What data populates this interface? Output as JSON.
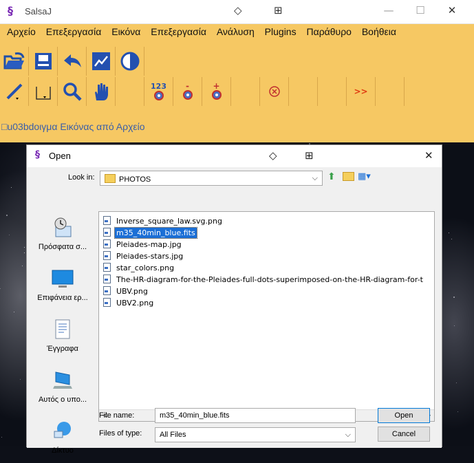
{
  "app": {
    "title": "SalsaJ",
    "menu": [
      "Αρχείο",
      "Επεξεργασία",
      "Εικόνα",
      "Επεξεργασία",
      "Ανάλυση",
      "Plugins",
      "Παράθυρο",
      "Βοήθεια"
    ],
    "status_text": "□u03bdοιγμα Εικόνας από Αρχείο",
    "toolbar_badges": {
      "count": "123",
      "minus": "-",
      "plus": "+",
      "more": ">>"
    }
  },
  "dialog": {
    "title": "Open",
    "look_in_label": "Look in:",
    "look_in_value": "PHOTOS",
    "places": [
      {
        "label": "Πρόσφατα σ...",
        "icon": "recent-places-icon"
      },
      {
        "label": "Επιφάνεια ερ...",
        "icon": "desktop-icon"
      },
      {
        "label": "Έγγραφα",
        "icon": "documents-icon"
      },
      {
        "label": "Αυτός ο υπο...",
        "icon": "computer-icon"
      },
      {
        "label": "Δίκτυο",
        "icon": "network-icon"
      }
    ],
    "files": [
      "Inverse_square_law.svg.png",
      "m35_40min_blue.fits",
      "Pleiades-map.jpg",
      "Pleiades-stars.jpg",
      "star_colors.png",
      "The-HR-diagram-for-the-Pleiades-full-dots-superimposed-on-the-HR-diagram-for-t",
      "UBV.png",
      "UBV2.png"
    ],
    "selected_file": "m35_40min_blue.fits",
    "file_name_label": "File name:",
    "file_name_value": "m35_40min_blue.fits",
    "files_of_type_label": "Files of type:",
    "files_of_type_value": "All Files",
    "open_button": "Open",
    "cancel_button": "Cancel"
  },
  "colors": {
    "salsa_bg": "#f6c863",
    "selection": "#1b6fd6"
  }
}
